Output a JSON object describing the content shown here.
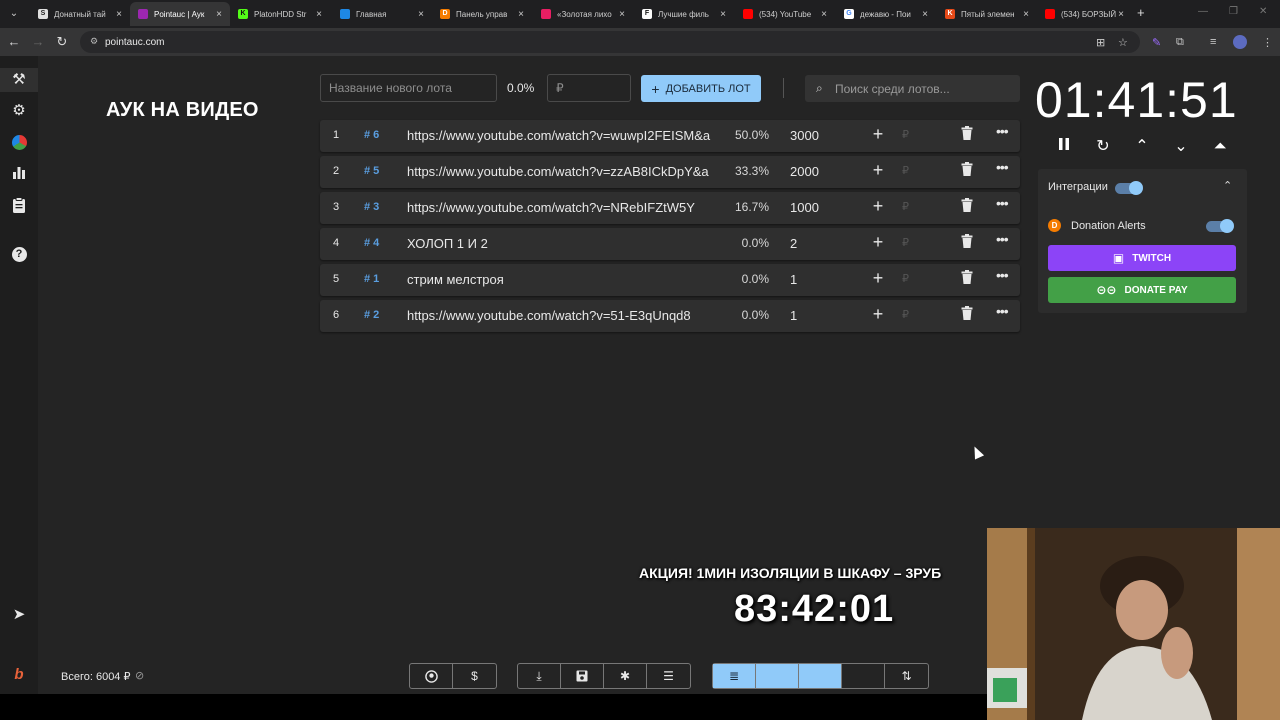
{
  "browser": {
    "tabs": [
      {
        "title": "Донатный тай",
        "favicon_letter": "S",
        "favicon_color": "#e0e0e0",
        "favicon_text_color": "#222"
      },
      {
        "title": "Pointauc | Аук",
        "favicon_letter": "",
        "favicon_color": "#9c27b0",
        "active": true
      },
      {
        "title": "PlatonHDD Str",
        "favicon_letter": "K",
        "favicon_color": "#53fc18",
        "favicon_text_color": "#111"
      },
      {
        "title": "Главная",
        "favicon_letter": "",
        "favicon_color": "#1e88e5"
      },
      {
        "title": "Панель управ",
        "favicon_letter": "D",
        "favicon_color": "#f57c00"
      },
      {
        "title": "«Золотая лихо",
        "favicon_letter": "",
        "favicon_color": "#e91e63"
      },
      {
        "title": "Лучшие филь",
        "favicon_letter": "F",
        "favicon_color": "#fafafa",
        "favicon_text_color": "#111"
      },
      {
        "title": "(534) YouTube",
        "favicon_letter": "",
        "favicon_color": "#ff0000"
      },
      {
        "title": "дежавю - Пои",
        "favicon_letter": "G",
        "favicon_color": "#ffffff",
        "favicon_text_color": "#4285f4"
      },
      {
        "title": "Пятый элемен",
        "favicon_letter": "K",
        "favicon_color": "#e64a19"
      },
      {
        "title": "(534) БОРЗЫЙ",
        "favicon_letter": "",
        "favicon_color": "#ff0000"
      }
    ],
    "url": "pointauc.com"
  },
  "auction": {
    "title": "АУК НА ВИДЕО",
    "new_lot_placeholder": "Название нового лота",
    "new_lot_percent": "0.0%",
    "amount_placeholder": "₽",
    "add_lot_label": "ДОБАВИТЬ ЛОТ",
    "search_placeholder": "Поиск среди лотов...",
    "lots": [
      {
        "index": "1",
        "tag": "# 6",
        "name": "https://www.youtube.com/watch?v=wuwpI2FEISM&a",
        "percent": "50.0%",
        "amount": "3000",
        "currency": "₽"
      },
      {
        "index": "2",
        "tag": "# 5",
        "name": "https://www.youtube.com/watch?v=zzAB8ICkDpY&a",
        "percent": "33.3%",
        "amount": "2000",
        "currency": "₽"
      },
      {
        "index": "3",
        "tag": "# 3",
        "name": "https://www.youtube.com/watch?v=NRebIFZtW5Y",
        "percent": "16.7%",
        "amount": "1000",
        "currency": "₽"
      },
      {
        "index": "4",
        "tag": "# 4",
        "name": "ХОЛОП 1 И 2",
        "percent": "0.0%",
        "amount": "2",
        "currency": "₽"
      },
      {
        "index": "5",
        "tag": "# 1",
        "name": "стрим мелстроя",
        "percent": "0.0%",
        "amount": "1",
        "currency": "₽"
      },
      {
        "index": "6",
        "tag": "# 2",
        "name": "https://www.youtube.com/watch?v=51-E3qUnqd8",
        "percent": "0.0%",
        "amount": "1",
        "currency": "₽"
      }
    ],
    "total": "Всего: 6004 ₽"
  },
  "timer": {
    "value": "01:41:51"
  },
  "integrations": {
    "header": "Интеграции",
    "donation_alerts_label": "Donation Alerts",
    "twitch_label": "TWITCH",
    "donatepay_label": "DONATE PAY"
  },
  "overlay": {
    "promo": "АКЦИЯ! 1МИН ИЗОЛЯЦИИ В ШКАФУ – 3РУБ",
    "timer": "83:42:01"
  },
  "colors": {
    "accent": "#90caf9",
    "twitch": "#8c44f7",
    "donatepay": "#43a047",
    "tag": "#5a9ee0"
  }
}
